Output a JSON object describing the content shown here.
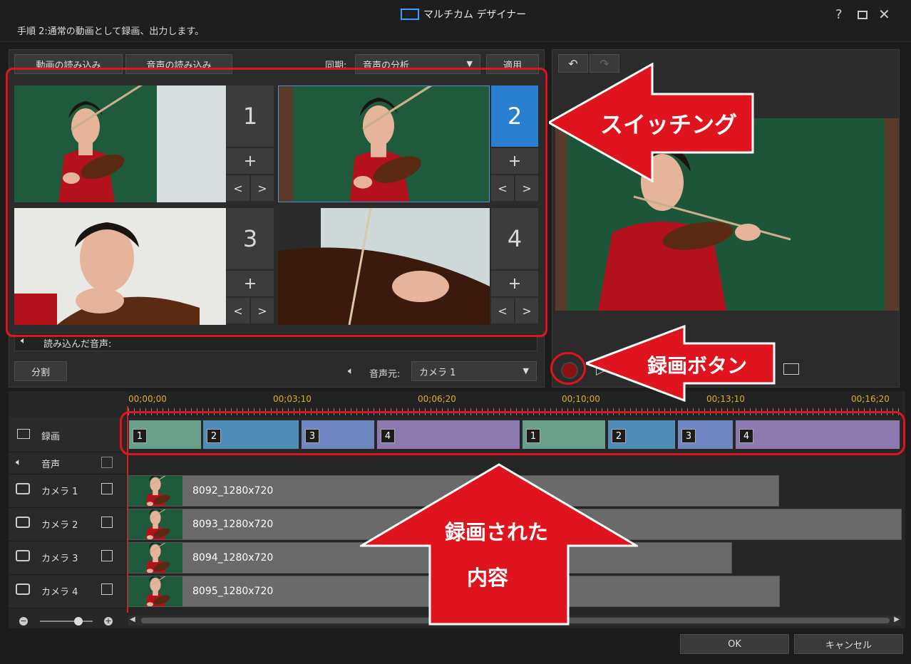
{
  "window": {
    "title": "マルチカム デザイナー",
    "help_label": "?",
    "step_text": "手順 2:通常の動画として録画、出力します。"
  },
  "toolbar": {
    "import_video": "動画の読み込み",
    "import_audio": "音声の読み込み",
    "sync_label": "同期:",
    "sync_value": "音声の分析",
    "apply": "適用"
  },
  "cameras": [
    {
      "number": "1",
      "selected": false
    },
    {
      "number": "2",
      "selected": true
    },
    {
      "number": "3",
      "selected": false
    },
    {
      "number": "4",
      "selected": false
    }
  ],
  "audio_bar": {
    "text": "読み込んだ音声:"
  },
  "controls": {
    "split": "分割",
    "audio_source_label": "音声元:",
    "audio_source_value": "カメラ 1"
  },
  "ruler": [
    "00;00;00",
    "00;03;10",
    "00;06;20",
    "00;10;00",
    "00;13;10",
    "00;16;20"
  ],
  "tracks": {
    "record": "録画",
    "audio": "音声",
    "cam1": "カメラ 1",
    "cam2": "カメラ 2",
    "cam3": "カメラ 3",
    "cam4": "カメラ 4"
  },
  "record_clips": [
    "1",
    "2",
    "3",
    "4",
    "1",
    "2",
    "3",
    "4"
  ],
  "camera_clips": [
    {
      "name": "8092_1280x720"
    },
    {
      "name": "8093_1280x720"
    },
    {
      "name": "8094_1280x720"
    },
    {
      "name": "8095_1280x720"
    }
  ],
  "footer": {
    "ok": "OK",
    "cancel": "キャンセル"
  },
  "annotations": {
    "switching": "スイッチング",
    "record_button": "録画ボタン",
    "recorded_line1": "録画された",
    "recorded_line2": "内容"
  },
  "colors": {
    "accent_blue": "#2a7fd0",
    "annotation_red": "#e0141e",
    "clip_cam1": "#6aa08a",
    "clip_cam2": "#4f8db8",
    "clip_cam3": "#6f86c0",
    "clip_cam4": "#8e78b0"
  }
}
